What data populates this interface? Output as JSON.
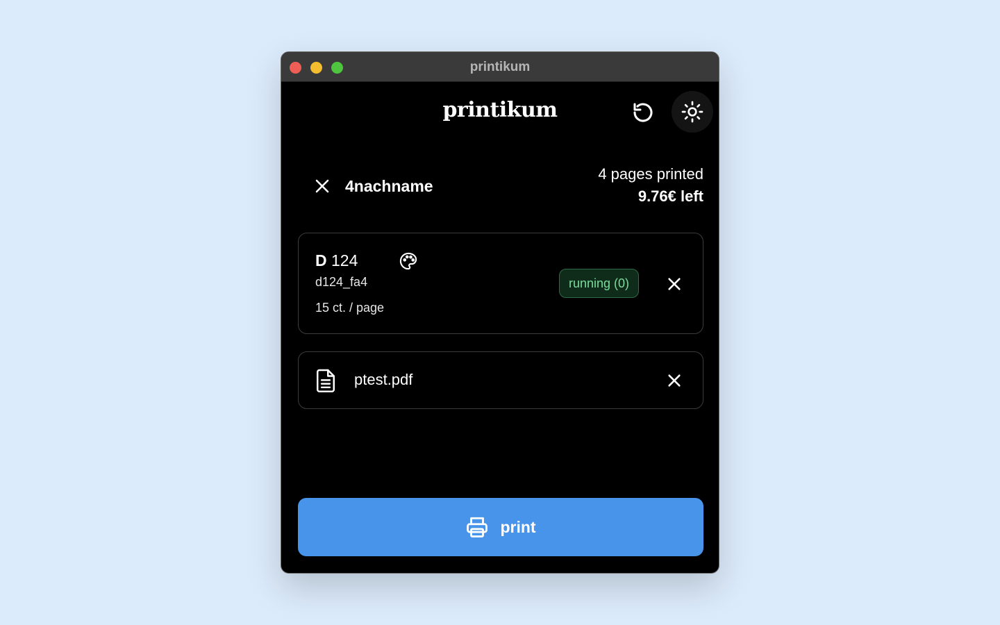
{
  "window": {
    "title": "printikum"
  },
  "header": {
    "brand": "printikum",
    "icons": [
      "reload-icon",
      "sun-icon"
    ]
  },
  "user": {
    "name": "4nachname",
    "pages_printed": "4 pages printed",
    "balance": "9.76€ left"
  },
  "printer": {
    "name_prefix": "D",
    "name_number": "124",
    "id": "d124_fa4",
    "price": "15 ct. / page",
    "status": "running (0)",
    "status_color": "#7cdc9b",
    "color_capable_icon": "palette-icon"
  },
  "file": {
    "name": "ptest.pdf",
    "icon": "file-text-icon"
  },
  "actions": {
    "print_label": "print",
    "accent_color": "#4894ea"
  }
}
